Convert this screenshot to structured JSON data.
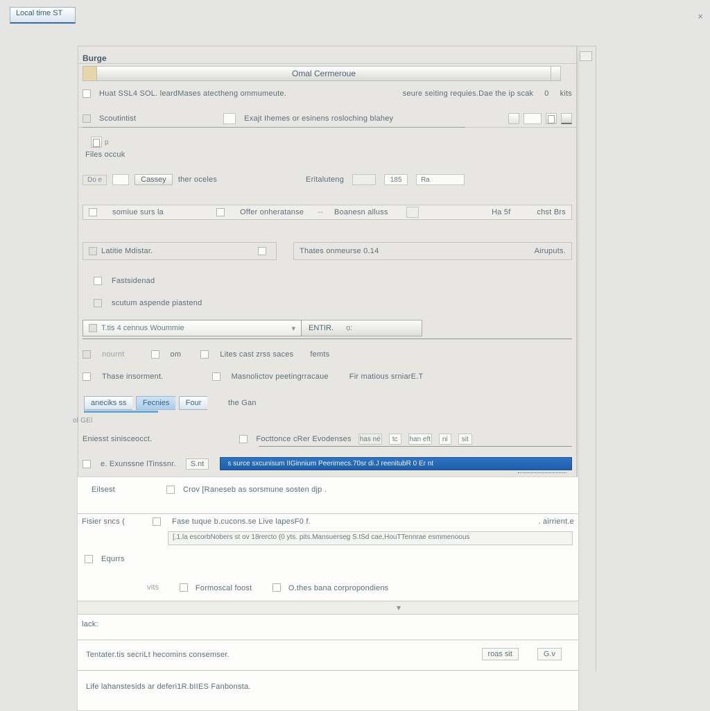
{
  "top_tab_label": "Local time ST",
  "close_icon": "×",
  "header": {
    "label": "Burge",
    "title": "Omal Cermeroue"
  },
  "row_host": {
    "text": "Huat  SSL4 SOL. leardMases   atectheng ommumeute.",
    "right_text": "seure seiting requies.Dae the ip   scak",
    "right_val": "0",
    "right_unit": "kits"
  },
  "row_s": {
    "label": "Scoutintist",
    "mid": "Exajt Ihemes or esinens rosloching blahey"
  },
  "files": {
    "label": "Files occuk"
  },
  "picker": {
    "btn": "Cassey",
    "after": "ther   oceles",
    "dep_label": "Eritaluteng",
    "m1": "",
    "m2": "185",
    "m3": "Ra"
  },
  "row_check": {
    "a": "somiue surs la",
    "b": "Offer onheratanse",
    "c": "Boanesn alluss",
    "r1": "Ha  5f",
    "r2": "chst Brs"
  },
  "cells": {
    "a": "Latitie   Mdistar.",
    "b": "Thates onmeurse 0.14",
    "b_right": "Airuputs."
  },
  "sec": {
    "a": "Fastsidenad",
    "b": "scutum aspende piastend"
  },
  "combo": {
    "value": "T.tis   4   cennus  Woummie",
    "btn": "ENTIR."
  },
  "row_lines": {
    "left": "nournt",
    "mid_chk": "om",
    "right": "Lites cast zrss saces",
    "right2": "femts"
  },
  "row_trans": {
    "left": "Thase insorment.",
    "mid": "Masnolictov peetingrracaue",
    "right": "Fir matious srniarE.T"
  },
  "tabs": {
    "a": "aneciks ss",
    "b": "Fecnies",
    "c": "Four",
    "after": "the Gan",
    "selected": 2
  },
  "gel": "ol GEl",
  "row_res": {
    "left": "Eniesst   sinisceocct.",
    "box_label": "Focttonce cRer Evodenses",
    "m1": "has né",
    "m2": "tc",
    "m3": "han eft",
    "m4": "ni",
    "m5": "sit"
  },
  "row_ex": {
    "left": "e.   Exunssne  lTinssnr.",
    "chip": "S.nt"
  },
  "blue_strip": "s surce sxcunisum IIGinnium Peerimecs.70sr  di.J reenitubR 0 Er nt",
  "dec": {
    "left": "Eilsest",
    "chk": "Crov [Raneseb as  sorsmune sosten djp ."
  },
  "row_face": {
    "a": "Fisier sncs (",
    "b": "Fase tuque b.cucons.se   Live   lapesF0  f.",
    "c": ". airrient.e"
  },
  "strip": "[.1.la escorbNobers st     ov 18rercto   (0 yts. pits.Mansuerseg S.tSd   cae,HouTTennrae     esmmenoous",
  "sec2": {
    "label": "Equrrs"
  },
  "row_n": {
    "a": "vits",
    "b": "Formoscal foost",
    "c": "O.thes bana corpropondiens"
  },
  "lack": "lack:",
  "term": "Tentater.tis  secriLt   hecomins consemser.",
  "foot_btn": {
    "a": "roas sit",
    "b": "G.v"
  },
  "last": "Life lahanstesids ar  deferi1R.bIIES    Fanbonsta."
}
